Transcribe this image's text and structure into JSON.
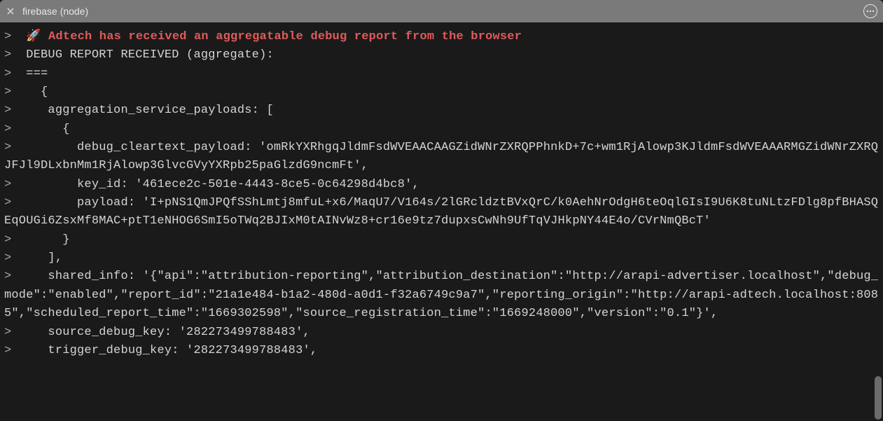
{
  "tab": {
    "title": "firebase (node)"
  },
  "lines": {
    "l0": {
      "prompt": ">  ",
      "rocket": "🚀 ",
      "headline": "Adtech has received an aggregatable debug report from the browser"
    },
    "l1": {
      "prompt": ">  ",
      "text": "DEBUG REPORT RECEIVED (aggregate):"
    },
    "l2": {
      "prompt": ">  ",
      "text": "==="
    },
    "l3": {
      "prompt": ">  ",
      "text": "  {"
    },
    "l4": {
      "prompt": ">  ",
      "text": "   aggregation_service_payloads: ["
    },
    "l5": {
      "prompt": ">  ",
      "text": "     {"
    },
    "l6": {
      "prompt": ">  ",
      "text": "       debug_cleartext_payload: 'omRkYXRhgqJldmFsdWVEAACAAGZidWNrZXRQPPhnkD+7c+wm1RjAlowp3KJldmFsdWVEAAARMGZidWNrZXRQJFJl9DLxbnMm1RjAlowp3GlvcGVyYXRpb25paGlzdG9ncmFt',"
    },
    "l7": {
      "prompt": ">  ",
      "text": "       key_id: '461ece2c-501e-4443-8ce5-0c64298d4bc8',"
    },
    "l8": {
      "prompt": ">  ",
      "text": "       payload: 'I+pNS1QmJPQfSShLmtj8mfuL+x6/MaqU7/V164s/2lGRcldztBVxQrC/k0AehNrOdgH6teOqlGIsI9U6K8tuNLtzFDlg8pfBHASQEqOUGi6ZsxMf8MAC+ptT1eNHOG6SmI5oTWq2BJIxM0tAINvWz8+cr16e9tz7dupxsCwNh9UfTqVJHkpNY44E4o/CVrNmQBcT'"
    },
    "l9": {
      "prompt": ">  ",
      "text": "     }"
    },
    "l10": {
      "prompt": ">  ",
      "text": "   ],"
    },
    "l11": {
      "prompt": ">  ",
      "text": "   shared_info: '{\"api\":\"attribution-reporting\",\"attribution_destination\":\"http://arapi-advertiser.localhost\",\"debug_mode\":\"enabled\",\"report_id\":\"21a1e484-b1a2-480d-a0d1-f32a6749c9a7\",\"reporting_origin\":\"http://arapi-adtech.localhost:8085\",\"scheduled_report_time\":\"1669302598\",\"source_registration_time\":\"1669248000\",\"version\":\"0.1\"}',"
    },
    "l12": {
      "prompt": ">  ",
      "text": "   source_debug_key: '282273499788483',"
    },
    "l13": {
      "prompt": ">  ",
      "text": "   trigger_debug_key: '282273499788483',"
    }
  }
}
